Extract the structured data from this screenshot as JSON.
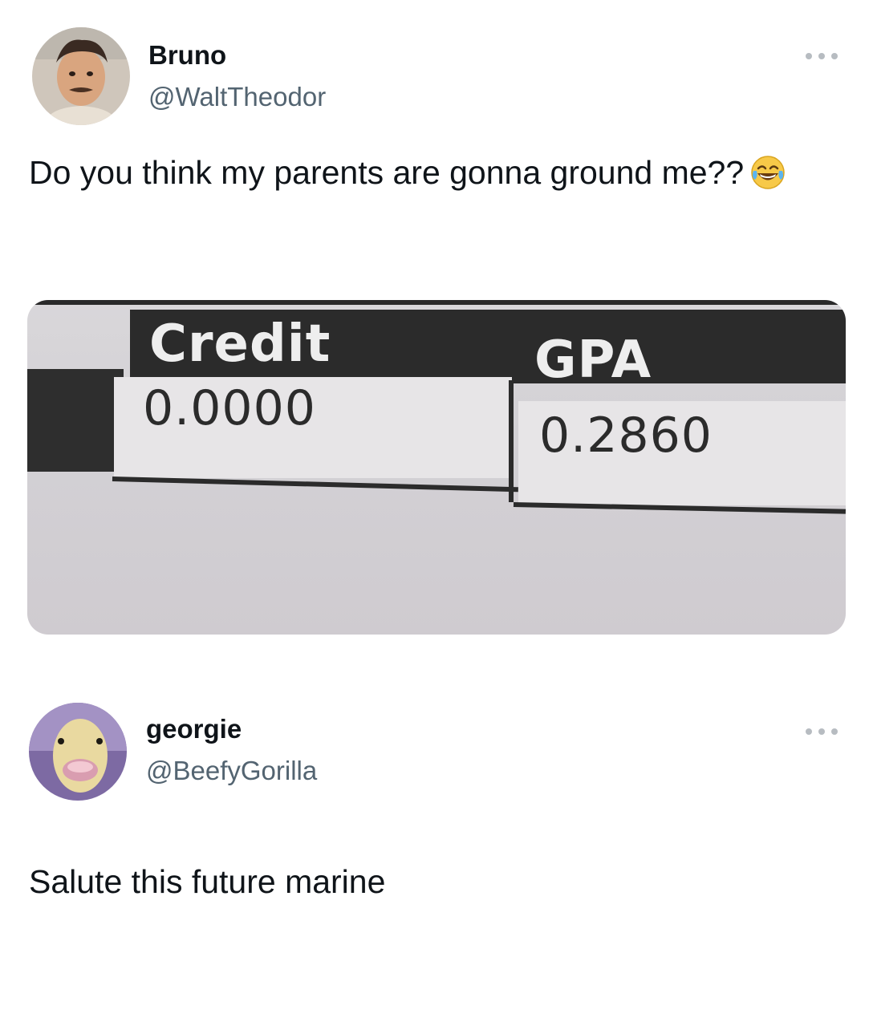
{
  "post": {
    "display_name": "Bruno",
    "handle": "@WaltTheodor",
    "text": "Do you think my parents are gonna ground me??",
    "emoji": "face-with-tears-of-joy",
    "media": {
      "headers": [
        "Credit",
        "GPA"
      ],
      "values": [
        "0.0000",
        "0.2860"
      ]
    }
  },
  "reply": {
    "display_name": "georgie",
    "handle": "@BeefyGorilla",
    "text": "Salute this future marine"
  }
}
